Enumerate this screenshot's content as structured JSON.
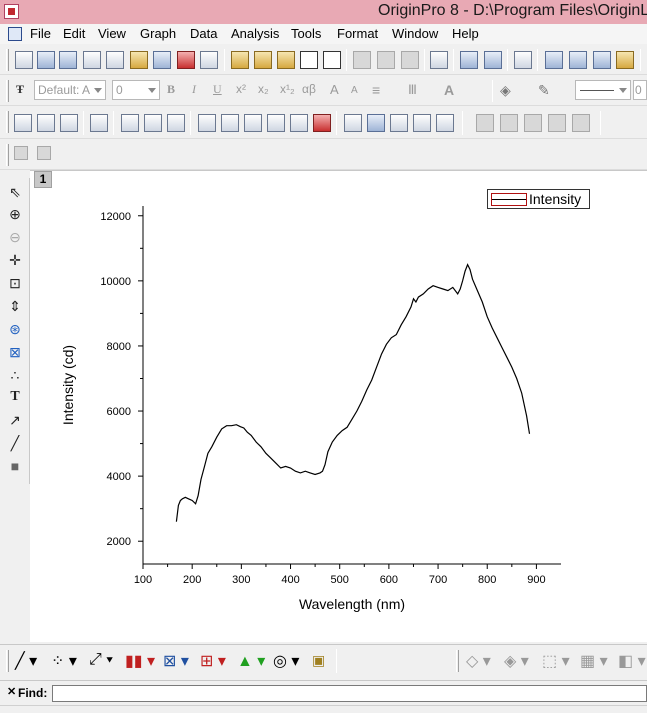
{
  "window": {
    "title": "OriginPro 8 - D:\\Program Files\\OriginL"
  },
  "menu": [
    "File",
    "Edit",
    "View",
    "Graph",
    "Data",
    "Analysis",
    "Tools",
    "Format",
    "Window",
    "Help"
  ],
  "format_toolbar": {
    "font_name": "Default: A",
    "font_size": "0",
    "bold": "B",
    "italic": "I",
    "underline": "U",
    "superscript": "x²",
    "subscript": "x₂",
    "supsub": "x¹₂",
    "greek": "αβ",
    "grow_font": "A",
    "shrink_font": "A"
  },
  "layer_tab": "1",
  "find": {
    "label": "Find:",
    "value": ""
  },
  "icons": [
    "select-pointer",
    "zoom-in",
    "zoom-out",
    "screen-reader",
    "data-reader",
    "data-selector",
    "draw-data",
    "mask",
    "text-tool",
    "arrow-tool",
    "line-tool",
    "rectangle-tool"
  ],
  "chart_data": {
    "type": "line",
    "xlabel": "Wavelength (nm)",
    "ylabel": "Intensity (cd)",
    "xlim": [
      100,
      950
    ],
    "ylim": [
      1300,
      12300
    ],
    "x_ticks": [
      100,
      200,
      300,
      400,
      500,
      600,
      700,
      800,
      900
    ],
    "y_ticks": [
      2000,
      4000,
      6000,
      8000,
      10000,
      12000
    ],
    "legend": {
      "position": "top-right",
      "entries": [
        "Intensity"
      ]
    },
    "series": [
      {
        "name": "Intensity",
        "color": "#000000",
        "x": [
          168,
          172,
          176,
          180,
          186,
          193,
          200,
          207,
          212,
          218,
          225,
          232,
          240,
          250,
          260,
          270,
          280,
          290,
          298,
          305,
          312,
          320,
          330,
          340,
          350,
          360,
          370,
          380,
          390,
          400,
          410,
          420,
          430,
          440,
          450,
          460,
          465,
          470,
          476,
          485,
          495,
          505,
          515,
          525,
          535,
          545,
          555,
          565,
          575,
          585,
          595,
          605,
          615,
          625,
          635,
          645,
          650,
          655,
          660,
          670,
          680,
          690,
          700,
          710,
          720,
          730,
          740,
          745,
          750,
          755,
          760,
          765,
          770,
          780,
          790,
          800,
          810,
          820,
          830,
          840,
          850,
          860,
          870,
          880,
          886
        ],
        "y": [
          2600,
          3100,
          3250,
          3300,
          3350,
          3300,
          3250,
          3150,
          3400,
          3900,
          4300,
          4700,
          4900,
          5200,
          5450,
          5550,
          5550,
          5580,
          5520,
          5480,
          5350,
          5250,
          5050,
          4900,
          4700,
          4550,
          4400,
          4250,
          4300,
          4250,
          4150,
          4100,
          4150,
          4100,
          4050,
          4100,
          4150,
          4350,
          4750,
          5050,
          5250,
          5400,
          5500,
          5750,
          6000,
          6300,
          6650,
          6950,
          7350,
          7750,
          8050,
          8250,
          8350,
          8650,
          8900,
          9200,
          9450,
          9350,
          9500,
          9600,
          9750,
          9850,
          9800,
          9750,
          9700,
          9800,
          9600,
          9750,
          10000,
          10300,
          10500,
          10350,
          10050,
          9700,
          9350,
          8900,
          8550,
          8250,
          7950,
          7650,
          7350,
          7000,
          6550,
          5850,
          5300
        ]
      }
    ]
  }
}
